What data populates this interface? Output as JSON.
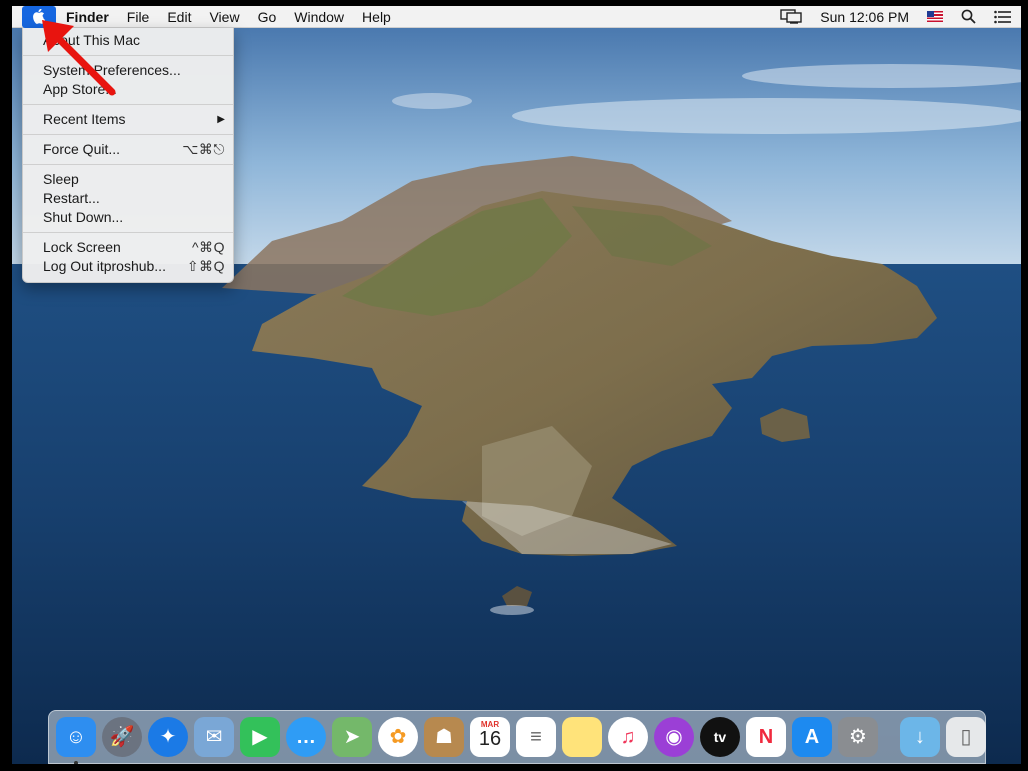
{
  "menubar": {
    "apple_icon": "apple-logo-icon",
    "items": [
      "Finder",
      "File",
      "Edit",
      "View",
      "Go",
      "Window",
      "Help"
    ],
    "clock": "Sun 12:06 PM",
    "status_icons": [
      "display-mirroring-icon",
      "us-flag-input-icon",
      "spotlight-search-icon",
      "notification-center-icon"
    ]
  },
  "apple_menu": {
    "about": "About This Mac",
    "system_prefs": "System Preferences...",
    "app_store": "App Store...",
    "recent_items": "Recent Items",
    "recent_arrow": "▶",
    "force_quit": "Force Quit...",
    "force_quit_shortcut": "⌥⌘⎋",
    "sleep": "Sleep",
    "restart": "Restart...",
    "shut_down": "Shut Down...",
    "lock_screen": "Lock Screen",
    "lock_screen_shortcut": "^⌘Q",
    "log_out": "Log Out itproshub...",
    "log_out_shortcut": "⇧⌘Q"
  },
  "annotation": {
    "color": "#e8140f"
  },
  "dock": {
    "apps": [
      {
        "name": "Finder",
        "icon": "finder-icon",
        "color": "#2e8ef0",
        "running": true
      },
      {
        "name": "Launchpad",
        "icon": "launchpad-icon",
        "color": "#6b7380"
      },
      {
        "name": "Safari",
        "icon": "safari-icon",
        "color": "#1b7ae6"
      },
      {
        "name": "Mail",
        "icon": "mail-icon",
        "color": "#7aa7d6"
      },
      {
        "name": "FaceTime",
        "icon": "facetime-icon",
        "color": "#33c15a"
      },
      {
        "name": "Messages",
        "icon": "messages-icon",
        "color": "#2f9cf5"
      },
      {
        "name": "Maps",
        "icon": "maps-icon",
        "color": "#74b86a"
      },
      {
        "name": "Photos",
        "icon": "photos-icon",
        "color": "#ffffff"
      },
      {
        "name": "Contacts",
        "icon": "contacts-icon",
        "color": "#b7894f"
      },
      {
        "name": "Calendar",
        "icon": "calendar-icon",
        "color": "#ffffff",
        "month": "MAR",
        "day": "16"
      },
      {
        "name": "Reminders",
        "icon": "reminders-icon",
        "color": "#ffffff"
      },
      {
        "name": "Notes",
        "icon": "notes-icon",
        "color": "#ffe37a"
      },
      {
        "name": "Music",
        "icon": "music-icon",
        "color": "#ffffff"
      },
      {
        "name": "Podcasts",
        "icon": "podcasts-icon",
        "color": "#9b3fd6"
      },
      {
        "name": "TV",
        "icon": "apple-tv-icon",
        "color": "#111111",
        "label": "tv"
      },
      {
        "name": "News",
        "icon": "news-icon",
        "color": "#ffffff"
      },
      {
        "name": "App Store",
        "icon": "app-store-icon",
        "color": "#1d8af0"
      },
      {
        "name": "System Preferences",
        "icon": "system-preferences-icon",
        "color": "#8a8d91"
      }
    ],
    "others": [
      {
        "name": "Downloads",
        "icon": "downloads-folder-icon",
        "color": "#6cb6e8"
      },
      {
        "name": "Trash",
        "icon": "trash-icon",
        "color": "#e6e8ea"
      }
    ]
  }
}
